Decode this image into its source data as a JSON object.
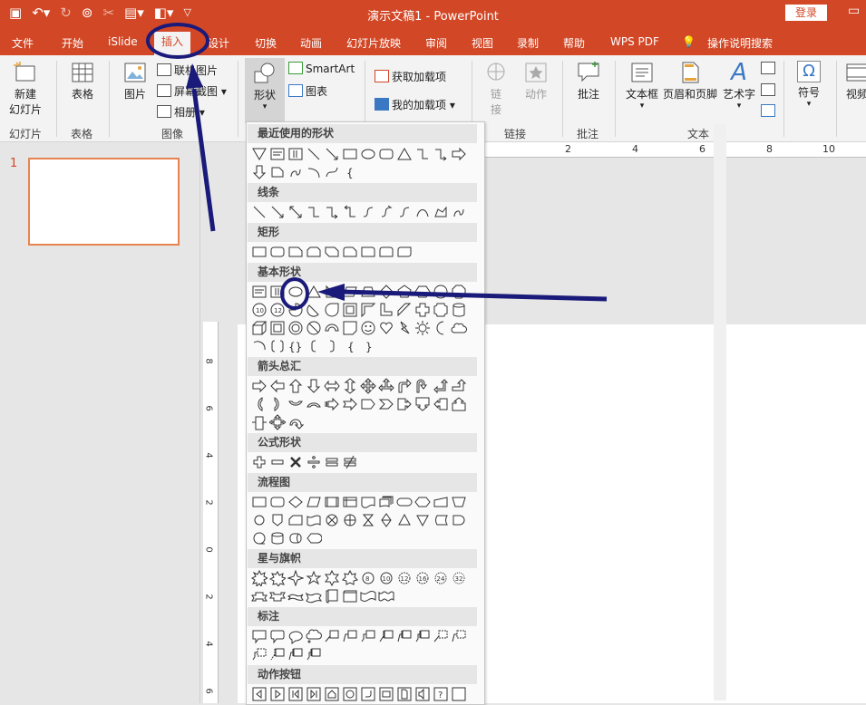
{
  "window": {
    "title": "演示文稿1  -  PowerPoint",
    "login_label": "登录",
    "quick_access": [
      "save-icon",
      "undo-icon",
      "redo-icon",
      "present-icon",
      "cut-icon",
      "format-icon",
      "export-icon",
      "customize-icon"
    ]
  },
  "menu": {
    "tabs": [
      "文件",
      "开始",
      "iSlide",
      "插入",
      "设计",
      "切换",
      "动画",
      "幻灯片放映",
      "审阅",
      "视图",
      "录制",
      "帮助",
      "WPS PDF"
    ],
    "active_tab": "插入",
    "tell_me": "操作说明搜索"
  },
  "ribbon": {
    "new_slide": [
      "新建",
      "幻灯片"
    ],
    "table": "表格",
    "picture": "图片",
    "online_picture": "联机图片",
    "screenshot": "屏幕截图",
    "album": "相册",
    "shapes": "形状",
    "smartart": "SmartArt",
    "chart": "图表",
    "get_addins": "获取加载项",
    "my_addins": "我的加载项",
    "link": [
      "链",
      "接"
    ],
    "action": "动作",
    "comment": "批注",
    "textbox": "文本框",
    "header_footer": "页眉和页脚",
    "wordart": "艺术字",
    "symbol": "符号",
    "video": "视频",
    "groups": {
      "slides": "幻灯片",
      "table": "表格",
      "images": "图像",
      "links": "链接",
      "comments": "批注",
      "text": "文本"
    }
  },
  "slides_panel": {
    "slide_number": "1"
  },
  "ruler": {
    "h_ticks": [
      "2",
      "4",
      "6",
      "8",
      "10"
    ],
    "v_ticks": [
      "8",
      "6",
      "4",
      "2",
      "0",
      "2",
      "4",
      "6"
    ]
  },
  "shapes_dropdown": {
    "groups": [
      "最近使用的形状",
      "线条",
      "矩形",
      "基本形状",
      "箭头总汇",
      "公式形状",
      "流程图",
      "星与旗帜",
      "标注",
      "动作按钮"
    ]
  }
}
